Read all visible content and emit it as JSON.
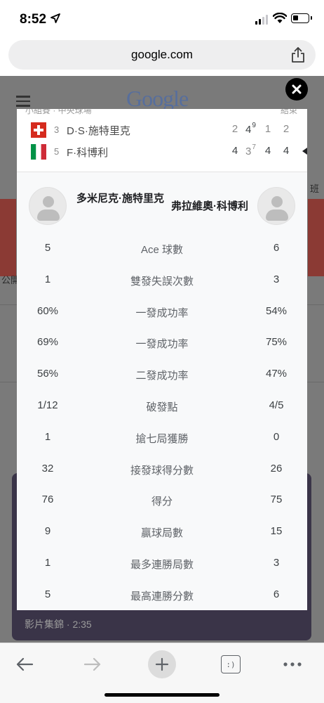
{
  "status_bar": {
    "time": "8:52"
  },
  "browser": {
    "url": "google.com"
  },
  "background_page": {
    "logo": "Google",
    "video_caption": "影片集錦 · 2:35",
    "edge_left": "公開",
    "edge_right": "班"
  },
  "match": {
    "header_peek_left": "小組賽 · 中央球場",
    "header_peek_right": "結束",
    "players": [
      {
        "seed": "3",
        "name": "D·S·施特里克",
        "flag": "switzerland",
        "sets": [
          "2",
          "4",
          "1",
          "2"
        ],
        "tiebreak": {
          "set_index": 1,
          "value": "9"
        },
        "winner_sets": [
          false,
          true,
          false,
          false
        ]
      },
      {
        "seed": "5",
        "name": "F·科博利",
        "flag": "italy",
        "sets": [
          "4",
          "3",
          "4",
          "4"
        ],
        "tiebreak": {
          "set_index": 1,
          "value": "7"
        },
        "winner_sets": [
          true,
          false,
          true,
          true
        ]
      }
    ]
  },
  "comparison": {
    "left_player": "多米尼克·施特里克",
    "right_player": "弗拉維奧·科博利",
    "stats": [
      {
        "label": "Ace 球數",
        "left": "5",
        "right": "6"
      },
      {
        "label": "雙發失誤次數",
        "left": "1",
        "right": "3"
      },
      {
        "label": "一發成功率",
        "left": "60%",
        "right": "54%"
      },
      {
        "label": "一發成功率",
        "left": "69%",
        "right": "75%"
      },
      {
        "label": "二發成功率",
        "left": "56%",
        "right": "47%"
      },
      {
        "label": "破發點",
        "left": "1/12",
        "right": "4/5"
      },
      {
        "label": "搶七局獲勝",
        "left": "1",
        "right": "0"
      },
      {
        "label": "接發球得分數",
        "left": "32",
        "right": "26"
      },
      {
        "label": "得分",
        "left": "76",
        "right": "75"
      },
      {
        "label": "贏球局數",
        "left": "9",
        "right": "15"
      },
      {
        "label": "最多連勝局數",
        "left": "1",
        "right": "3"
      },
      {
        "label": "最高連勝分數",
        "left": "5",
        "right": "6"
      }
    ]
  },
  "toolbar": {
    "tabs_label": ":)"
  },
  "colors": {
    "overlay": "#7a7a7a",
    "modal_bg": "#f8f9fa",
    "swiss_red": "#d52b1e",
    "italy_green": "#009246",
    "italy_red": "#ce2b37"
  },
  "icons": [
    "location-arrow-icon",
    "signal-icon",
    "wifi-icon",
    "battery-icon",
    "share-icon",
    "close-icon",
    "swiss-flag-icon",
    "italian-flag-icon",
    "back-arrow-icon",
    "forward-arrow-icon",
    "plus-icon",
    "tabs-icon",
    "more-icon"
  ]
}
